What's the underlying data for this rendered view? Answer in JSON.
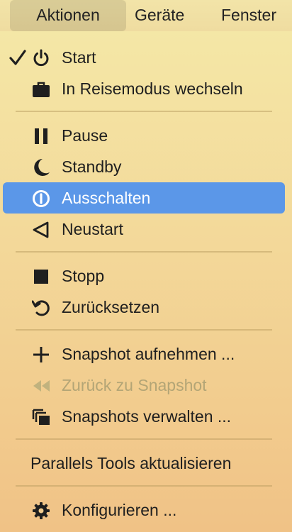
{
  "menubar": {
    "items": [
      {
        "label": "Aktionen",
        "active": true
      },
      {
        "label": "Geräte",
        "active": false
      },
      {
        "label": "Fenster",
        "active": false
      }
    ]
  },
  "menu": {
    "items": [
      {
        "label": "Start",
        "icon": "power-icon",
        "checked": true
      },
      {
        "label": "In Reisemodus wechseln",
        "icon": "briefcase-icon"
      },
      {
        "label": "Pause",
        "icon": "pause-icon"
      },
      {
        "label": "Standby",
        "icon": "moon-icon"
      },
      {
        "label": "Ausschalten",
        "icon": "shutdown-icon",
        "highlighted": true
      },
      {
        "label": "Neustart",
        "icon": "restart-triangle-icon"
      },
      {
        "label": "Stopp",
        "icon": "stop-icon"
      },
      {
        "label": "Zurücksetzen",
        "icon": "reset-arrow-icon"
      },
      {
        "label": "Snapshot aufnehmen ...",
        "icon": "plus-icon"
      },
      {
        "label": "Zurück zu Snapshot",
        "icon": "rewind-icon",
        "disabled": true
      },
      {
        "label": "Snapshots verwalten ...",
        "icon": "snapshots-stack-icon"
      },
      {
        "label": "Parallels Tools aktualisieren"
      },
      {
        "label": "Konfigurieren ...",
        "icon": "gear-icon"
      }
    ]
  },
  "colors": {
    "highlight": "#5b97e8",
    "text": "#1f1f1f",
    "disabled_text": "#b3a576"
  }
}
